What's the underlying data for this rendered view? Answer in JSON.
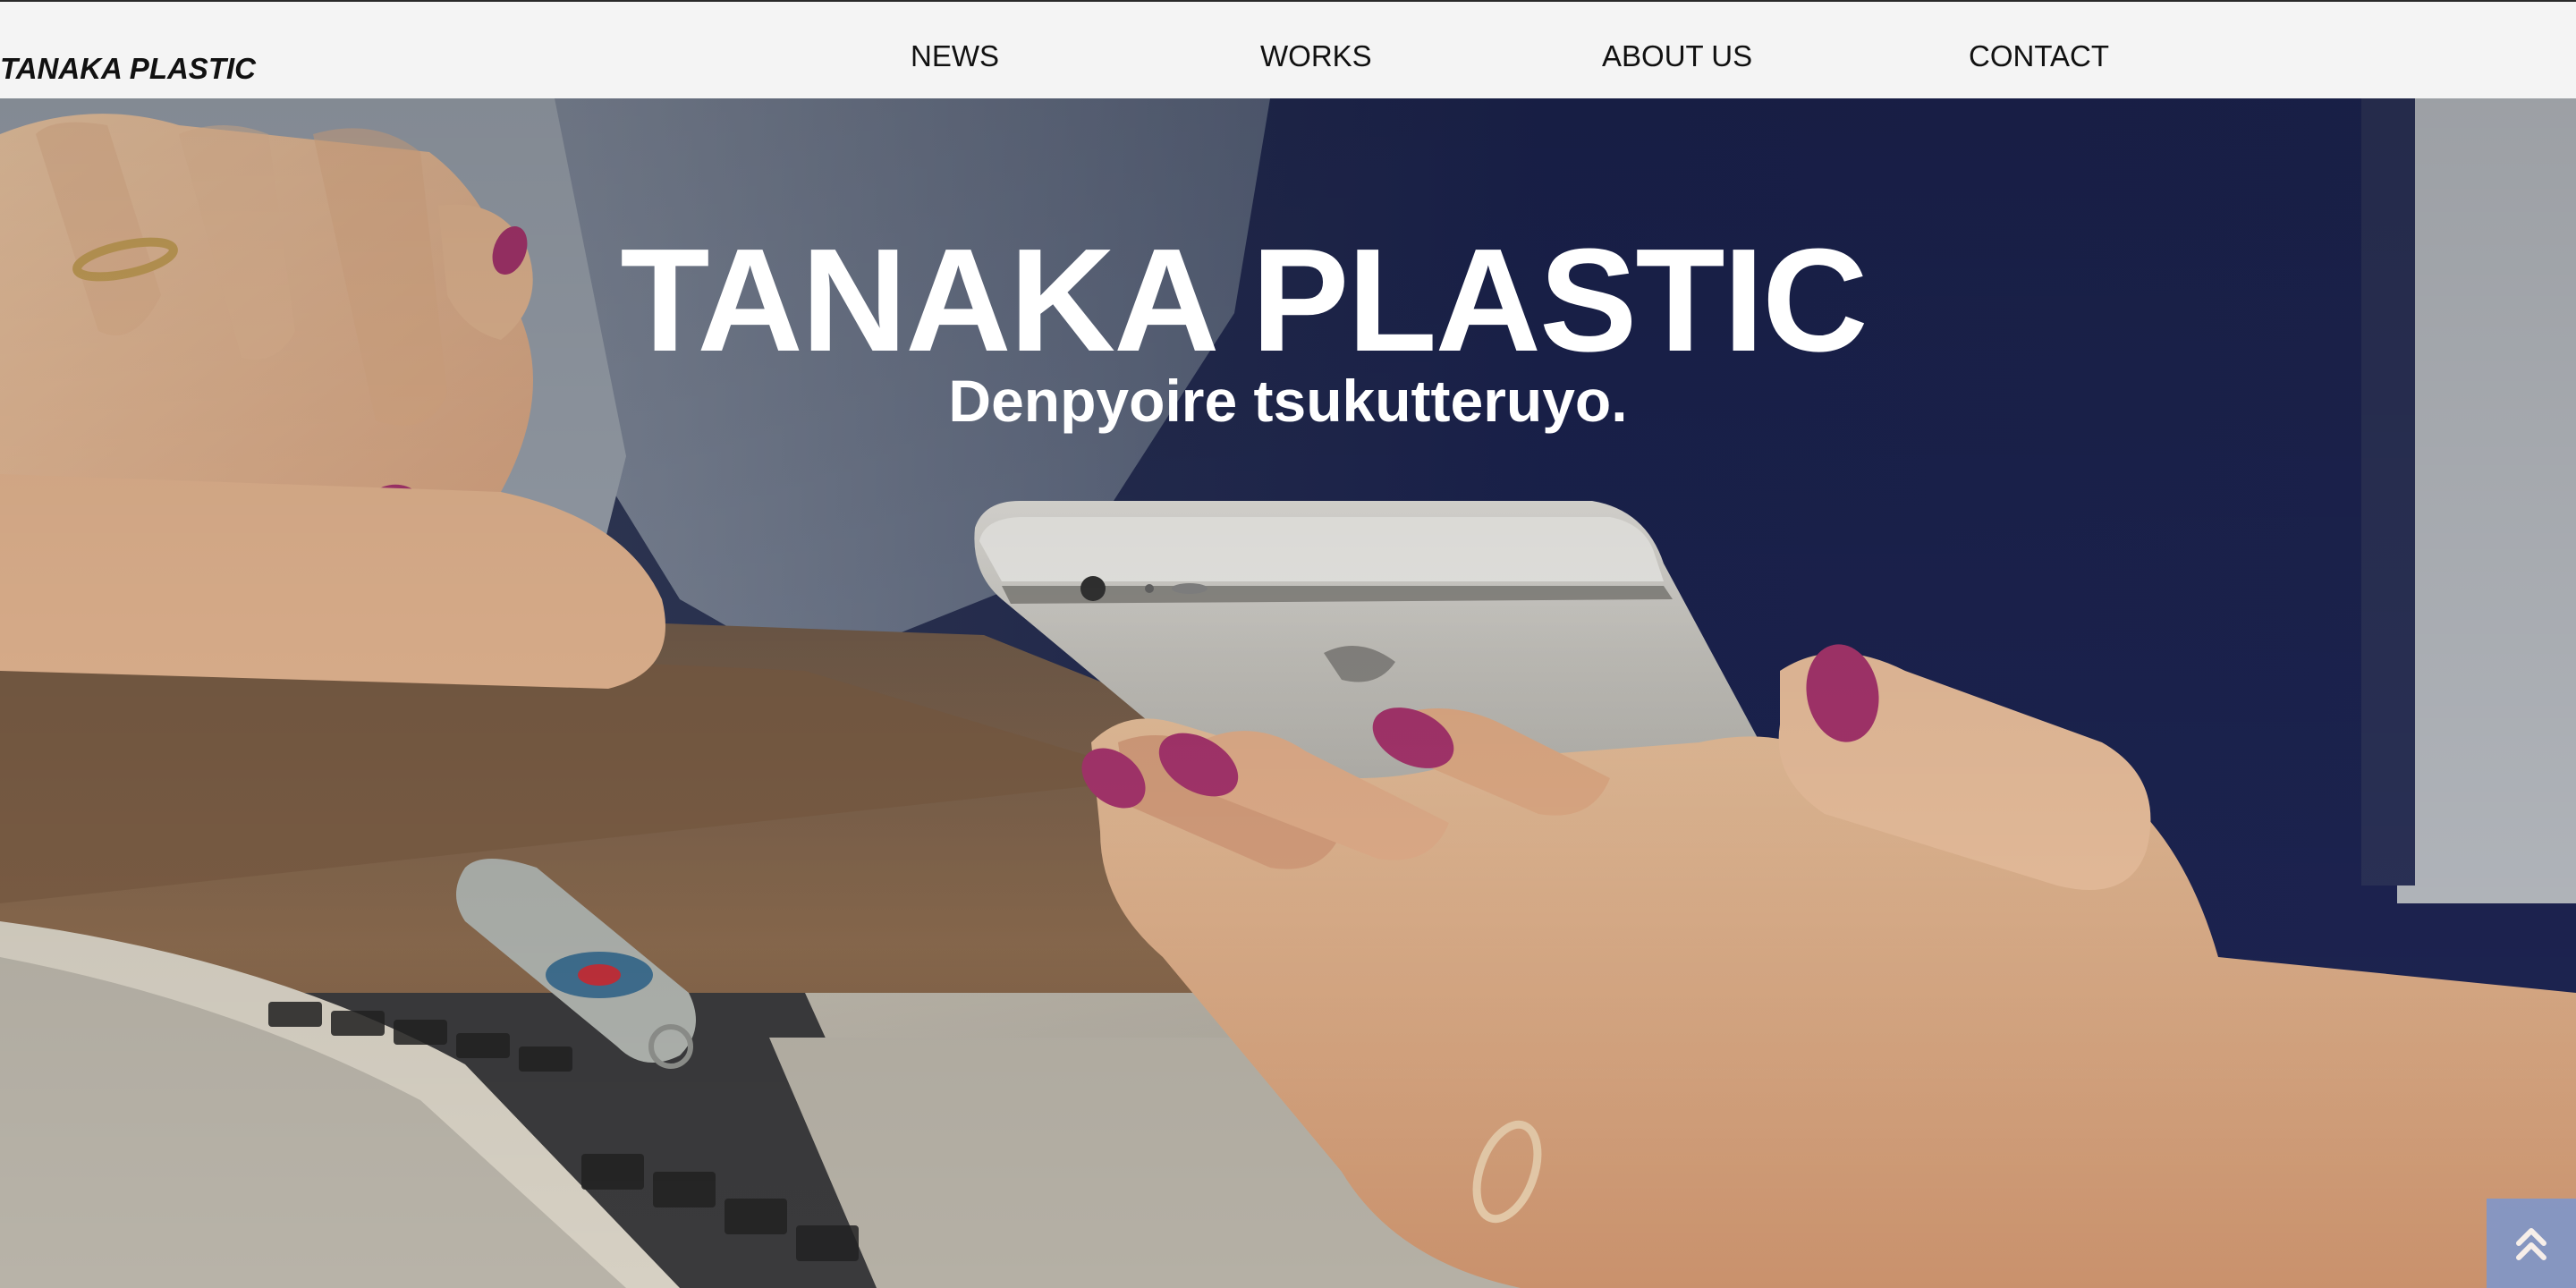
{
  "header": {
    "logo": "TANAKA PLASTIC",
    "nav": {
      "news": "NEWS",
      "works": "WORKS",
      "about": "ABOUT US",
      "contact": "CONTACT"
    }
  },
  "hero": {
    "title": "TANAKA PLASTIC",
    "subtitle": "Denpyoire tsukutteruyo."
  },
  "scroll_top": {
    "icon": "double-chevron-up-icon"
  },
  "colors": {
    "header_bg": "#f4f4f4",
    "hero_text": "#ffffff",
    "scroll_top_bg": "#7b97cf",
    "nail_polish": "#a8356e",
    "dark_navy": "#1b2350"
  }
}
